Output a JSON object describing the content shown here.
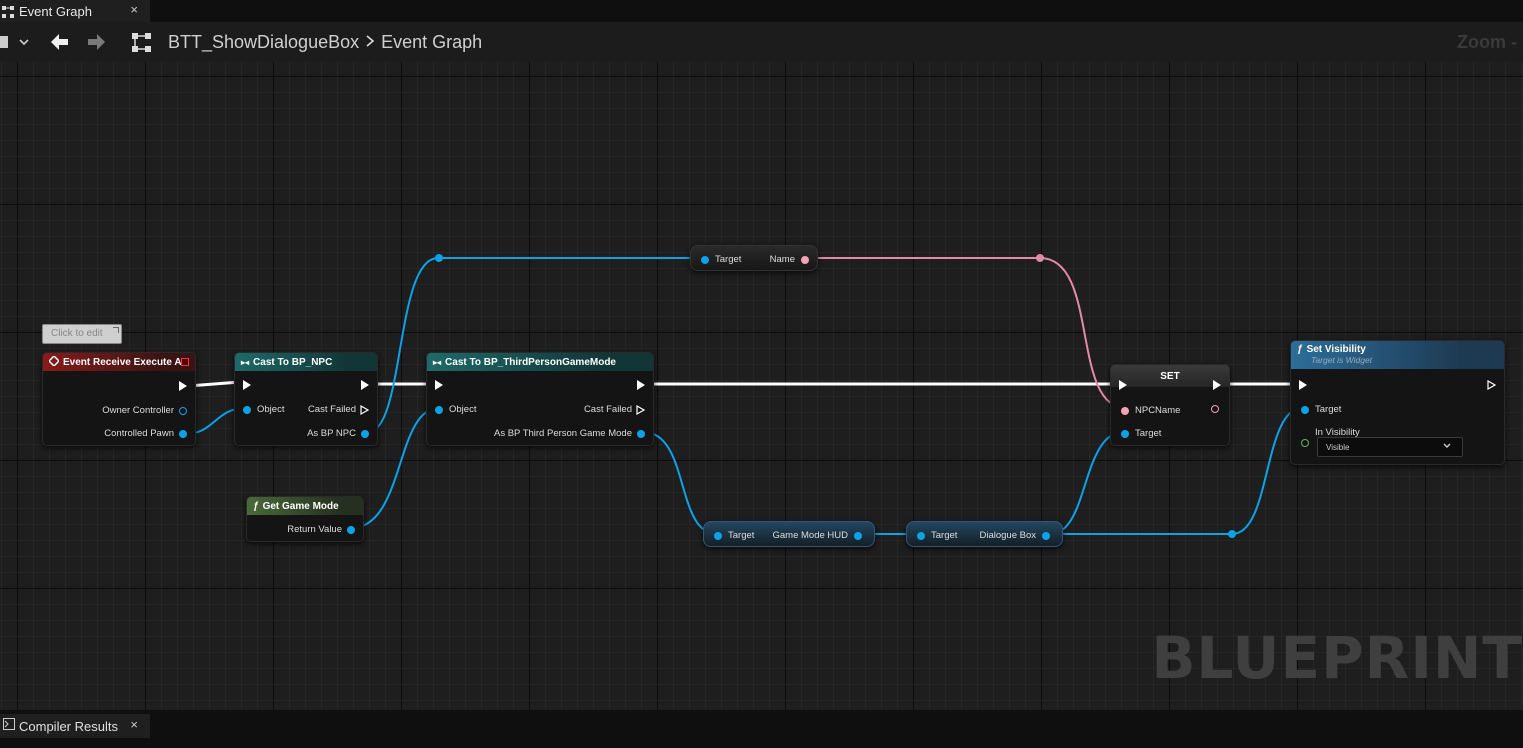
{
  "tabs": {
    "event_graph": "Event Graph",
    "compiler_results": "Compiler Results",
    "close_glyph": "×"
  },
  "nav": {
    "breadcrumb": [
      "BTT_ShowDialogueBox",
      "Event Graph"
    ],
    "zoom": "Zoom -"
  },
  "tooltip": "Click to edit",
  "watermark": "BLUEPRINT",
  "nodes": {
    "event_receive": {
      "title": "Event Receive Execute AI",
      "pins": {
        "owner_controller": "Owner Controller",
        "controlled_pawn": "Controlled Pawn"
      }
    },
    "cast_npc": {
      "title": "Cast To BP_NPC",
      "pins": {
        "object": "Object",
        "cast_failed": "Cast Failed",
        "as_npc": "As BP NPC"
      }
    },
    "get_game_mode": {
      "title": "Get Game Mode",
      "pins": {
        "return_value": "Return Value"
      }
    },
    "cast_gamemode": {
      "title": "Cast To BP_ThirdPersonGameMode",
      "pins": {
        "object": "Object",
        "cast_failed": "Cast Failed",
        "as_gamemode": "As BP Third Person Game Mode"
      }
    },
    "get_name": {
      "target": "Target",
      "output": "Name"
    },
    "get_hud": {
      "target": "Target",
      "output": "Game Mode HUD"
    },
    "get_dialogue": {
      "target": "Target",
      "output": "Dialogue Box"
    },
    "set_var": {
      "title": "SET",
      "pins": {
        "npc_name": "NPCName",
        "target": "Target"
      }
    },
    "set_visibility": {
      "title": "Set Visibility",
      "subtitle": "Target is Widget",
      "pins": {
        "target": "Target",
        "in_visibility": "In Visibility"
      },
      "visibility_value": "Visible"
    }
  },
  "colors": {
    "object_pin": "#0aa3ea",
    "string_pin": "#f6a0b9",
    "exec_wire": "#ffffff",
    "event_header": "#8a1a1a",
    "cast_header": "#1e6a6a",
    "pure_function_header": "#4a6a3a",
    "function_header": "#2c6e9a"
  },
  "icons": {
    "tab_graph": "graph-icon",
    "menu": "hamburger-icon",
    "back": "arrow-left-icon",
    "forward": "arrow-right-icon",
    "breadcrumb_graph": "graph-node-icon",
    "function": "function-icon",
    "event": "event-diamond-icon",
    "cast": "cast-arrows-icon",
    "terminal": "terminal-icon"
  }
}
